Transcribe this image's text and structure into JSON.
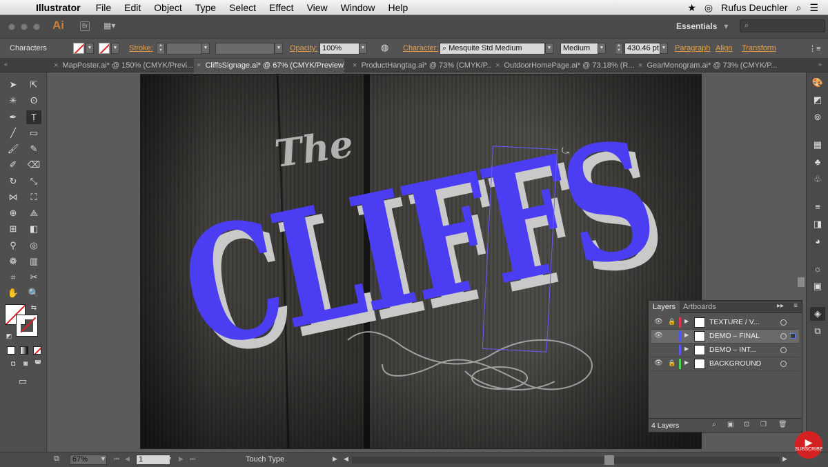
{
  "menubar": {
    "app_name": "Illustrator",
    "items": [
      "File",
      "Edit",
      "Object",
      "Type",
      "Select",
      "Effect",
      "View",
      "Window",
      "Help"
    ],
    "user": "Rufus Deuchler"
  },
  "appbar": {
    "logo": "Ai",
    "bridge": "Br",
    "workspace": "Essentials"
  },
  "control": {
    "selection": "Characters",
    "stroke_label": "Stroke:",
    "opacity_label": "Opacity:",
    "opacity_value": "100%",
    "character_label": "Character:",
    "font_family": "Mesquite Std Medium",
    "font_style": "Medium",
    "font_size": "430.46 pt",
    "paragraph": "Paragraph",
    "align": "Align",
    "transform": "Transform"
  },
  "tabs": [
    {
      "label": "MapPoster.ai* @ 150% (CMYK/Previ..."
    },
    {
      "label": "CliffsSignage.ai* @ 67% (CMYK/Preview)"
    },
    {
      "label": "ProductHangtag.ai* @ 73% (CMYK/P..."
    },
    {
      "label": "OutdoorHomePage.ai* @ 73.18% (R..."
    },
    {
      "label": "GearMonogram.ai* @ 73% (CMYK/P..."
    }
  ],
  "artwork": {
    "script_word": "The",
    "headline": "CLIFFS",
    "colors": {
      "headline": "#4b3df2",
      "shadow": "#c9c9c9",
      "wood": "#3a3a38"
    }
  },
  "layers_panel": {
    "tab_layers": "Layers",
    "tab_artboards": "Artboards",
    "rows": [
      {
        "name": "TEXTURE / V...",
        "color": "#e0344f",
        "locked": true,
        "visible": true
      },
      {
        "name": "DEMO – FINAL",
        "color": "#4e55ff",
        "locked": false,
        "visible": true,
        "selected": true
      },
      {
        "name": "DEMO – INT...",
        "color": "#5a5aff",
        "locked": false,
        "visible": false
      },
      {
        "name": "BACKGROUND",
        "color": "#47d14f",
        "locked": true,
        "visible": true
      }
    ],
    "count": "4 Layers"
  },
  "status": {
    "zoom": "67%",
    "page": "1",
    "mode": "Touch Type"
  },
  "youtube": {
    "label": "SUBSCRIBE"
  }
}
